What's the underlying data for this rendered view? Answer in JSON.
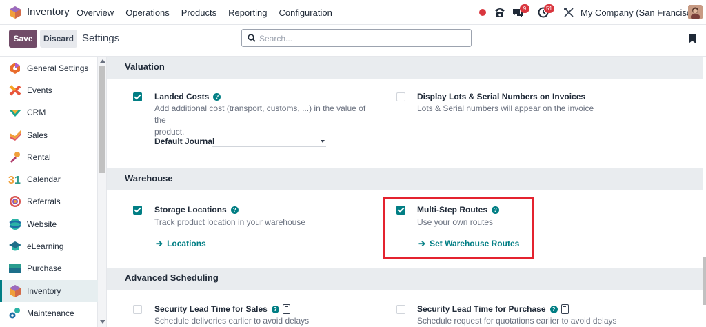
{
  "navbar": {
    "app_name": "Inventory",
    "menu": [
      "Overview",
      "Operations",
      "Products",
      "Reporting",
      "Configuration"
    ],
    "messages_badge": "9",
    "activities_badge": "51",
    "company": "My Company (San Francisco)"
  },
  "control": {
    "save_label": "Save",
    "discard_label": "Discard",
    "breadcrumb": "Settings",
    "search_placeholder": "Search..."
  },
  "sidebar": {
    "items": [
      {
        "label": "General Settings",
        "icon": "settings-hexagon-icon"
      },
      {
        "label": "Events",
        "icon": "events-icon"
      },
      {
        "label": "CRM",
        "icon": "crm-icon"
      },
      {
        "label": "Sales",
        "icon": "sales-icon"
      },
      {
        "label": "Rental",
        "icon": "rental-icon"
      },
      {
        "label": "Calendar",
        "icon": "calendar-icon"
      },
      {
        "label": "Referrals",
        "icon": "referrals-icon"
      },
      {
        "label": "Website",
        "icon": "website-icon"
      },
      {
        "label": "eLearning",
        "icon": "elearning-icon"
      },
      {
        "label": "Purchase",
        "icon": "purchase-icon"
      },
      {
        "label": "Inventory",
        "icon": "inventory-icon",
        "active": true
      },
      {
        "label": "Maintenance",
        "icon": "maintenance-icon"
      }
    ]
  },
  "sections": {
    "valuation": {
      "title": "Valuation",
      "landed_costs": {
        "title": "Landed Costs",
        "desc_line1": "Add additional cost (transport, customs, ...) in the value of the",
        "desc_line2": "product.",
        "checked": true,
        "field_label": "Default Journal",
        "field_value": ""
      },
      "lots_invoices": {
        "title": "Display Lots & Serial Numbers on Invoices",
        "desc": "Lots & Serial numbers will appear on the invoice",
        "checked": false
      }
    },
    "warehouse": {
      "title": "Warehouse",
      "storage_locations": {
        "title": "Storage Locations",
        "desc": "Track product location in your warehouse",
        "checked": true,
        "link": "Locations"
      },
      "multi_step_routes": {
        "title": "Multi-Step Routes",
        "desc": "Use your own routes",
        "checked": true,
        "link": "Set Warehouse Routes"
      }
    },
    "advanced_scheduling": {
      "title": "Advanced Scheduling",
      "lead_time_sales": {
        "title": "Security Lead Time for Sales",
        "desc": "Schedule deliveries earlier to avoid delays",
        "checked": false
      },
      "lead_time_purchase": {
        "title": "Security Lead Time for Purchase",
        "desc": "Schedule request for quotations earlier to avoid delays",
        "checked": false
      }
    }
  },
  "colors": {
    "brand": "#714b67",
    "accent": "#017e84",
    "highlight": "#e4232f",
    "badge": "#d9363e"
  }
}
